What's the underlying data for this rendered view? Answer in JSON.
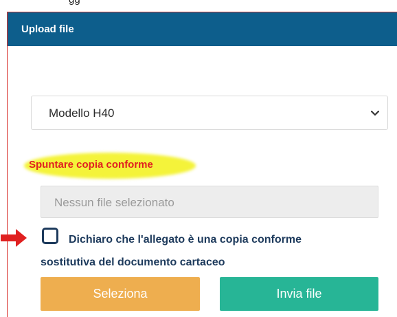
{
  "top_text": "gg",
  "dialog": {
    "title": "Upload file",
    "select": {
      "value": "Modello H40",
      "icon": "chevron-down-icon"
    },
    "warning": {
      "text": "Spuntare copia conforme",
      "highlight_color": "#f4f33a",
      "text_color": "#e02020"
    },
    "file_input": {
      "placeholder": "Nessun file selezionato"
    },
    "declaration": {
      "checked": false,
      "line1": "Dichiaro che l'allegato è una copia conforme",
      "line2": "sostitutiva del documento cartaceo"
    },
    "buttons": {
      "select_label": "Seleziona",
      "send_label": "Invia file"
    }
  },
  "colors": {
    "header": "#0d5e8c",
    "select_button": "#eeae4f",
    "send_button": "#27b596",
    "arrow": "#e02020",
    "checkbox_border": "#1d3a5c"
  }
}
